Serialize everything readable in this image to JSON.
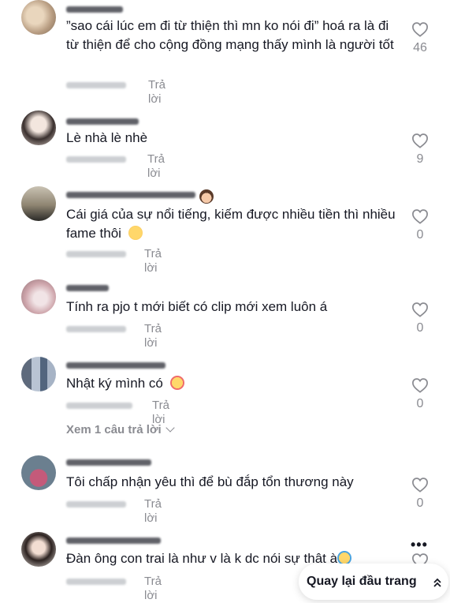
{
  "reply_label": "Trả lời",
  "comments": [
    {
      "text": "”sao cái lúc em đi từ thiện thì mn ko nói đi” hoá ra là đi từ thiện để cho cộng đồng mạng thấy mình là người tốt",
      "likes": "46"
    },
    {
      "text": "Lè nhà lè nhè",
      "likes": "9"
    },
    {
      "text": "Cái giá của sự nổi tiếng, kiếm được nhiều tiền thì nhiều fame thôi",
      "likes": "0"
    },
    {
      "text": "Tính ra pjo t mới biết có clip mới xem luôn á",
      "likes": "0"
    },
    {
      "text": "Nhật ký mình có",
      "likes": "0"
    },
    {
      "text": "Tôi chấp nhận yêu thì để bù đắp tổn thương này",
      "likes": "0"
    },
    {
      "text": "Đàn ông con trai là như v là k dc nói sự thật à"
    }
  ],
  "view_replies": "Xem 1 câu trả lời",
  "more_icon": "more-dots-icon",
  "back_to_top": "Quay lại đầu trang",
  "colors": {
    "text": "#161823",
    "muted": "#8a8b91"
  }
}
